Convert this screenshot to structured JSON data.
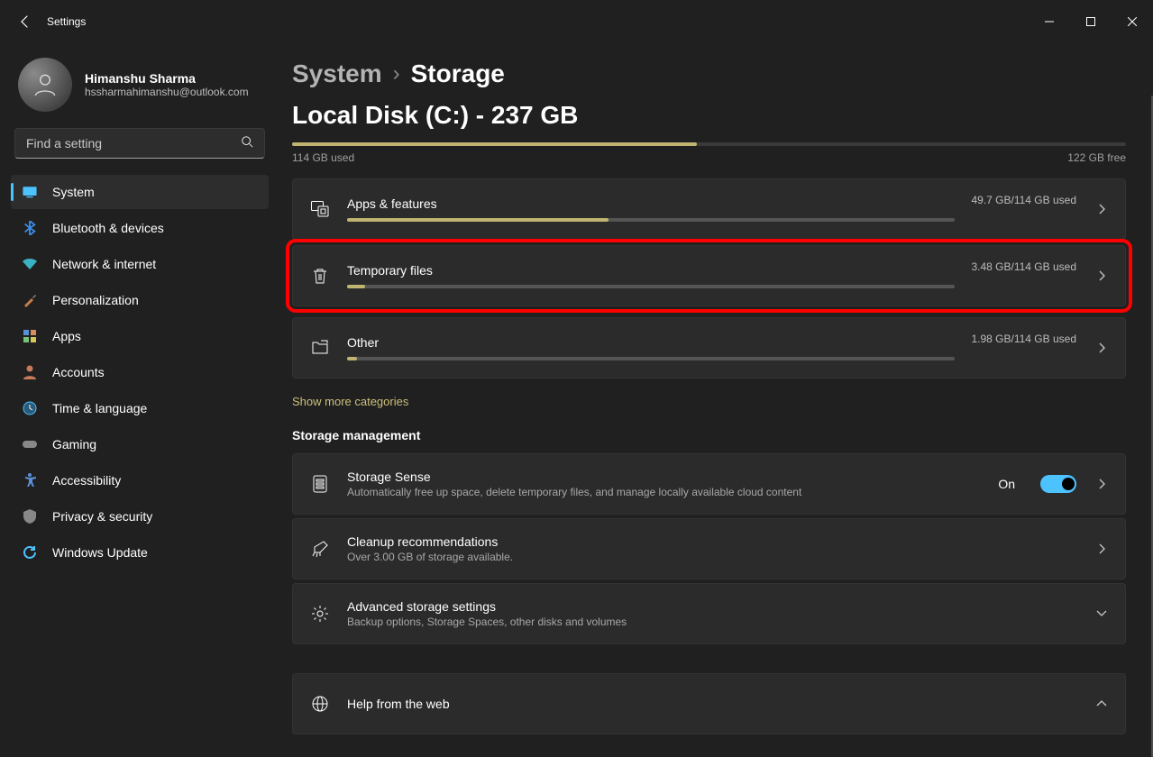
{
  "window": {
    "title": "Settings"
  },
  "user": {
    "name": "Himanshu Sharma",
    "email": "hssharmahimanshu@outlook.com"
  },
  "search": {
    "placeholder": "Find a setting"
  },
  "nav": {
    "items": [
      {
        "label": "System"
      },
      {
        "label": "Bluetooth & devices"
      },
      {
        "label": "Network & internet"
      },
      {
        "label": "Personalization"
      },
      {
        "label": "Apps"
      },
      {
        "label": "Accounts"
      },
      {
        "label": "Time & language"
      },
      {
        "label": "Gaming"
      },
      {
        "label": "Accessibility"
      },
      {
        "label": "Privacy & security"
      },
      {
        "label": "Windows Update"
      }
    ]
  },
  "breadcrumb": {
    "parent": "System",
    "current": "Storage"
  },
  "disk": {
    "title": "Local Disk (C:) - 237 GB",
    "used_label": "114 GB used",
    "free_label": "122 GB free",
    "fill_percent": 48.5
  },
  "categories": [
    {
      "title": "Apps & features",
      "right": "49.7 GB/114 GB used",
      "fill": 43
    },
    {
      "title": "Temporary files",
      "right": "3.48 GB/114 GB used",
      "fill": 3
    },
    {
      "title": "Other",
      "right": "1.98 GB/114 GB used",
      "fill": 1.7
    }
  ],
  "show_more": "Show more categories",
  "management": {
    "heading": "Storage management",
    "sense": {
      "title": "Storage Sense",
      "sub": "Automatically free up space, delete temporary files, and manage locally available cloud content",
      "state": "On"
    },
    "cleanup": {
      "title": "Cleanup recommendations",
      "sub": "Over 3.00 GB of storage available."
    },
    "advanced": {
      "title": "Advanced storage settings",
      "sub": "Backup options, Storage Spaces, other disks and volumes"
    },
    "help": {
      "title": "Help from the web"
    }
  }
}
